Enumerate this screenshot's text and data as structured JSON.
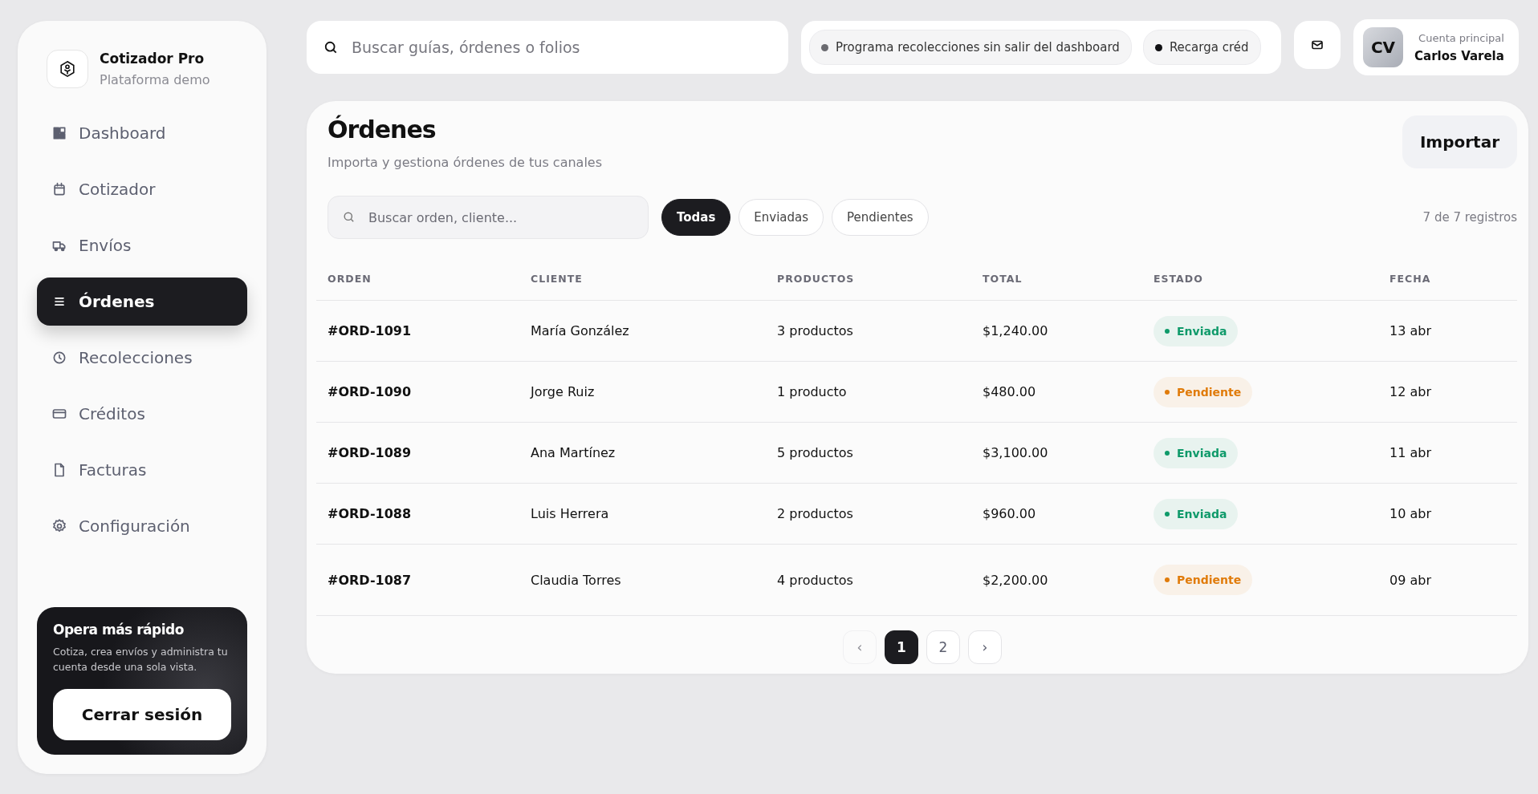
{
  "brand": {
    "name": "Cotizador Pro",
    "subtitle": "Plataforma demo"
  },
  "nav": [
    {
      "label": "Dashboard",
      "selected": false
    },
    {
      "label": "Cotizador",
      "selected": false
    },
    {
      "label": "Envíos",
      "selected": false
    },
    {
      "label": "Órdenes",
      "selected": true
    },
    {
      "label": "Recolecciones",
      "selected": false
    },
    {
      "label": "Créditos",
      "selected": false
    },
    {
      "label": "Facturas",
      "selected": false
    },
    {
      "label": "Configuración",
      "selected": false
    }
  ],
  "promo": {
    "title": "Opera más rápido",
    "text": "Cotiza, crea envíos y administra tu cuenta desde una sola vista.",
    "button": "Cerrar sesión"
  },
  "search": {
    "placeholder": "Buscar guías, órdenes o folios"
  },
  "ticker": [
    {
      "text": "Programa recolecciones sin salir del dashboard",
      "color": "#6b6b70"
    },
    {
      "text": "Recarga créd",
      "color": "#111114"
    }
  ],
  "account": {
    "initials": "CV",
    "label": "Cuenta principal",
    "name": "Carlos Varela"
  },
  "page": {
    "title": "Órdenes",
    "subtitle": "Importa y gestiona órdenes de tus canales",
    "import_button": "Importar"
  },
  "filter_search": {
    "placeholder": "Buscar orden, cliente..."
  },
  "filters": [
    {
      "label": "Todas",
      "selected": true
    },
    {
      "label": "Enviadas",
      "selected": false
    },
    {
      "label": "Pendientes",
      "selected": false
    }
  ],
  "count": "7 de 7 registros",
  "table": {
    "columns": [
      "ORDEN",
      "CLIENTE",
      "PRODUCTOS",
      "TOTAL",
      "ESTADO",
      "FECHA"
    ],
    "rows": [
      {
        "order": "#ORD-1091",
        "client": "María González",
        "products": "3 productos",
        "total": "$1,240.00",
        "status": "Enviada",
        "color": "#0f9a6a",
        "date": "13 abr"
      },
      {
        "order": "#ORD-1090",
        "client": "Jorge Ruiz",
        "products": "1 producto",
        "total": "$480.00",
        "status": "Pendiente",
        "color": "#e07b0a",
        "date": "12 abr"
      },
      {
        "order": "#ORD-1089",
        "client": "Ana Martínez",
        "products": "5 productos",
        "total": "$3,100.00",
        "status": "Enviada",
        "color": "#0f9a6a",
        "date": "11 abr"
      },
      {
        "order": "#ORD-1088",
        "client": "Luis Herrera",
        "products": "2 productos",
        "total": "$960.00",
        "status": "Enviada",
        "color": "#0f9a6a",
        "date": "10 abr"
      },
      {
        "order": "#ORD-1087",
        "client": "Claudia Torres",
        "products": "4 productos",
        "total": "$2,200.00",
        "status": "Pendiente",
        "color": "#e07b0a",
        "date": "09 abr"
      }
    ]
  },
  "pagination": {
    "prev": {
      "label": "‹",
      "disabled": true
    },
    "pages": [
      {
        "label": "1",
        "selected": true
      },
      {
        "label": "2",
        "selected": false
      }
    ],
    "next": {
      "label": "›",
      "disabled": false
    }
  }
}
